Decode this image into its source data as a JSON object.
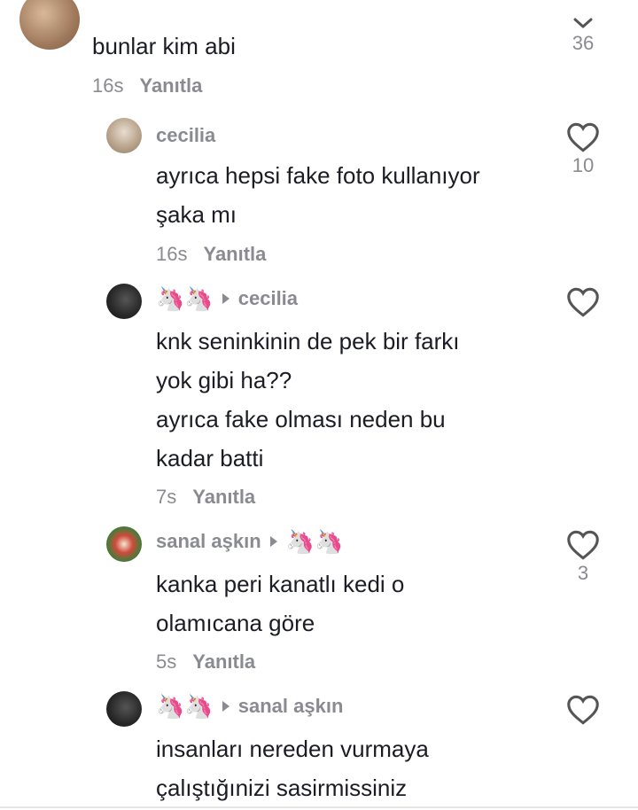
{
  "comments": [
    {
      "text_lines": [
        "bunlar kim abi"
      ],
      "time": "16s",
      "reply_label": "Yanıtla",
      "like_count": "36"
    },
    {
      "username": "cecilia",
      "text_lines": [
        "ayrıca hepsi fake foto kullanıyor",
        "şaka mı"
      ],
      "time": "16s",
      "reply_label": "Yanıtla",
      "like_count": "10"
    },
    {
      "username_emoji": "🦄🦄",
      "reply_to": "cecilia",
      "text_lines": [
        "knk seninkinin de pek bir farkı",
        "yok gibi ha??",
        "ayrıca fake olması neden bu",
        "kadar batti"
      ],
      "time": "7s",
      "reply_label": "Yanıtla"
    },
    {
      "username": "sanal aşkın",
      "reply_to_emoji": "🦄🦄",
      "text_lines": [
        "kanka peri kanatlı kedi o",
        "olamıcana göre"
      ],
      "time": "5s",
      "reply_label": "Yanıtla",
      "like_count": "3"
    },
    {
      "username_emoji": "🦄🦄",
      "reply_to": "sanal aşkın",
      "text_lines": [
        "insanları nereden vurmaya",
        "çalıştığınizi sasirmissiniz"
      ]
    }
  ],
  "colors": {
    "text": "#1b1c24",
    "muted": "#8a8b91",
    "background": "#ffffff"
  },
  "icons": {
    "like": "heart-outline-icon",
    "reply_indicator": "play-arrow-icon",
    "collapse": "chevron-down-icon"
  }
}
